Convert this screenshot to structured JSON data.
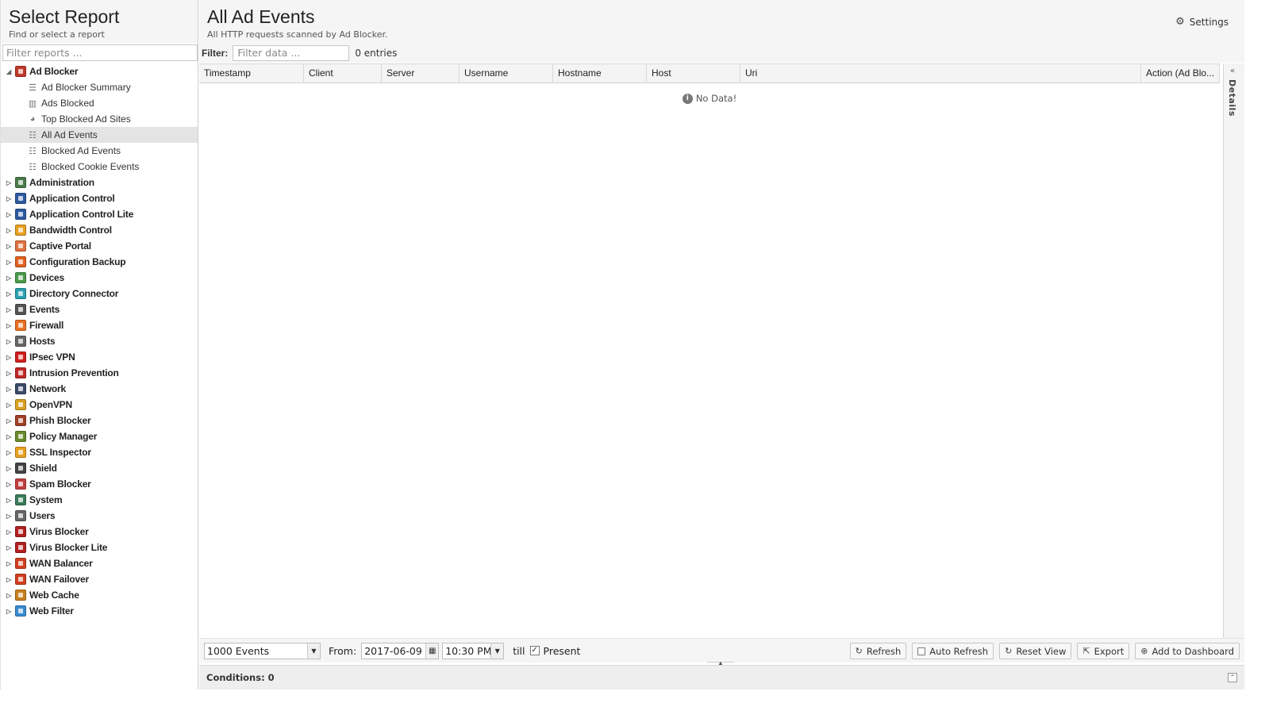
{
  "left": {
    "title": "Select Report",
    "subtitle": "Find or select a report",
    "filter_placeholder": "Filter reports ..."
  },
  "tree": {
    "open_category": {
      "label": "Ad Blocker",
      "color": "#c0392b"
    },
    "children": [
      {
        "label": "Ad Blocker Summary",
        "icon": "text-lines-icon",
        "glyph": "☰",
        "selected": false
      },
      {
        "label": "Ads Blocked",
        "icon": "bar-chart-icon",
        "glyph": "▥",
        "selected": false
      },
      {
        "label": "Top Blocked Ad Sites",
        "icon": "pie-chart-icon",
        "glyph": "◕",
        "selected": false
      },
      {
        "label": "All Ad Events",
        "icon": "list-icon",
        "glyph": "☷",
        "selected": true
      },
      {
        "label": "Blocked Ad Events",
        "icon": "list-icon",
        "glyph": "☷",
        "selected": false
      },
      {
        "label": "Blocked Cookie Events",
        "icon": "list-icon",
        "glyph": "☷",
        "selected": false
      }
    ],
    "categories": [
      {
        "label": "Administration",
        "color": "#4a7a4a"
      },
      {
        "label": "Application Control",
        "color": "#2c5aa0"
      },
      {
        "label": "Application Control Lite",
        "color": "#2c5aa0"
      },
      {
        "label": "Bandwidth Control",
        "color": "#e8a020"
      },
      {
        "label": "Captive Portal",
        "color": "#e07040"
      },
      {
        "label": "Configuration Backup",
        "color": "#e06020"
      },
      {
        "label": "Devices",
        "color": "#4a9a4a"
      },
      {
        "label": "Directory Connector",
        "color": "#2aa0b0"
      },
      {
        "label": "Events",
        "color": "#555555"
      },
      {
        "label": "Firewall",
        "color": "#e87020"
      },
      {
        "label": "Hosts",
        "color": "#666666"
      },
      {
        "label": "IPsec VPN",
        "color": "#d02020"
      },
      {
        "label": "Intrusion Prevention",
        "color": "#c02828"
      },
      {
        "label": "Network",
        "color": "#3a4a6a"
      },
      {
        "label": "OpenVPN",
        "color": "#d8a020"
      },
      {
        "label": "Phish Blocker",
        "color": "#a04028"
      },
      {
        "label": "Policy Manager",
        "color": "#6a8a2a"
      },
      {
        "label": "SSL Inspector",
        "color": "#e8a020"
      },
      {
        "label": "Shield",
        "color": "#444444"
      },
      {
        "label": "Spam Blocker",
        "color": "#c04040"
      },
      {
        "label": "System",
        "color": "#3a7a5a"
      },
      {
        "label": "Users",
        "color": "#666666"
      },
      {
        "label": "Virus Blocker",
        "color": "#b02020"
      },
      {
        "label": "Virus Blocker Lite",
        "color": "#b02020"
      },
      {
        "label": "WAN Balancer",
        "color": "#d04020"
      },
      {
        "label": "WAN Failover",
        "color": "#d04020"
      },
      {
        "label": "Web Cache",
        "color": "#c88020"
      },
      {
        "label": "Web Filter",
        "color": "#3a8ad0"
      }
    ]
  },
  "main": {
    "title": "All Ad Events",
    "subtitle": "All HTTP requests scanned by Ad Blocker.",
    "settings_label": "Settings",
    "filter_label": "Filter:",
    "filter_placeholder": "Filter data ...",
    "entries_text": "0 entries",
    "no_data": "No Data!",
    "details_label": "Details"
  },
  "grid": {
    "columns": [
      "Timestamp",
      "Client",
      "Server",
      "Username",
      "Hostname",
      "Host",
      "Uri",
      "Action (Ad Blo..."
    ]
  },
  "bottom": {
    "events_value": "1000 Events",
    "from_label": "From:",
    "date_value": "2017-06-09",
    "time_value": "10:30 PM",
    "till_label": "till",
    "present_label": "Present",
    "buttons": {
      "refresh": "Refresh",
      "auto_refresh": "Auto Refresh",
      "reset_view": "Reset View",
      "export": "Export",
      "add_dashboard": "Add to Dashboard"
    }
  },
  "conditions": {
    "label": "Conditions: 0"
  }
}
